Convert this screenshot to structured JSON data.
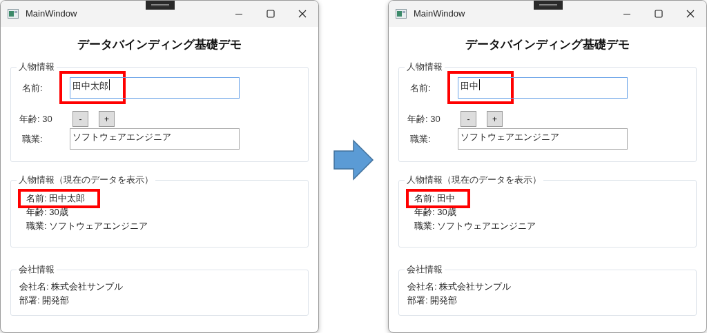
{
  "windows": [
    {
      "title": "MainWindow",
      "heading": "データバインディング基礎デモ",
      "person_group": {
        "legend": "人物情報",
        "name_label": "名前:",
        "name_value": "田中太郎",
        "name_focused": true,
        "name_highlighted": true,
        "age_label": "年齢: 30",
        "decrement": "-",
        "increment": "+",
        "job_label": "職業:",
        "job_value": "ソフトウェアエンジニア"
      },
      "display_group": {
        "legend": "人物情報（現在のデータを表示）",
        "lines": [
          {
            "text": "名前: 田中太郎",
            "highlighted": true
          },
          {
            "text": "年齢: 30歳",
            "highlighted": false
          },
          {
            "text": "職業: ソフトウェアエンジニア",
            "highlighted": false
          }
        ]
      },
      "company_group": {
        "legend": "会社情報",
        "lines": [
          "会社名: 株式会社サンプル",
          "部署: 開発部"
        ]
      }
    },
    {
      "title": "MainWindow",
      "heading": "データバインディング基礎デモ",
      "person_group": {
        "legend": "人物情報",
        "name_label": "名前:",
        "name_value": "田中",
        "name_focused": true,
        "name_highlighted": true,
        "age_label": "年齢: 30",
        "decrement": "-",
        "increment": "+",
        "job_label": "職業:",
        "job_value": "ソフトウェアエンジニア"
      },
      "display_group": {
        "legend": "人物情報（現在のデータを表示）",
        "lines": [
          {
            "text": "名前: 田中",
            "highlighted": true
          },
          {
            "text": "年齢: 30歳",
            "highlighted": false
          },
          {
            "text": "職業: ソフトウェアエンジニア",
            "highlighted": false
          }
        ]
      },
      "company_group": {
        "legend": "会社情報",
        "lines": [
          "会社名: 株式会社サンプル",
          "部署: 開発部"
        ]
      }
    }
  ]
}
